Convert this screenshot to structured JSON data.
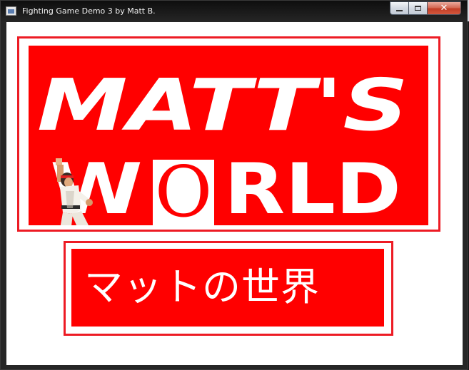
{
  "window": {
    "title": "Fighting Game Demo 3 by Matt B.",
    "minimize_icon": "minimize-icon",
    "maximize_icon": "maximize-icon",
    "close_icon": "close-icon"
  },
  "logo": {
    "line1": "MATT'S",
    "line2_parts": [
      "W",
      "O",
      "RLD"
    ],
    "colors": {
      "panel": "#ff0000",
      "border": "#ed1b24",
      "text": "#ffffff",
      "o_box": "#ffffff",
      "o_letter": "#ff0000"
    }
  },
  "subtitle": {
    "text": "マットの世界"
  },
  "character": {
    "icon": "fighter-sprite"
  }
}
